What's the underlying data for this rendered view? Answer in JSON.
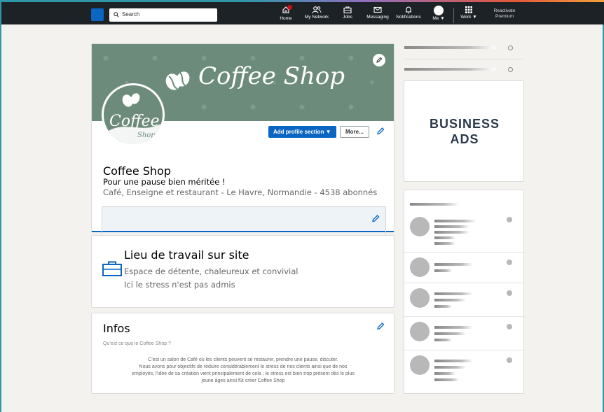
{
  "nav": {
    "search_placeholder": "Search",
    "items": [
      {
        "label": "Home"
      },
      {
        "label": "My Network"
      },
      {
        "label": "Jobs"
      },
      {
        "label": "Messaging"
      },
      {
        "label": "Notifications"
      },
      {
        "label": "Me ▼"
      },
      {
        "label": "Work ▼"
      }
    ],
    "premium_line1": "Reactivate",
    "premium_line2": "Premium"
  },
  "banner": {
    "title": "Coffee Shop",
    "avatar_word": "Coffee",
    "avatar_sub": "Shop"
  },
  "profile": {
    "add_section_label": "Add profile section ▼",
    "more_label": "More...",
    "name": "Coffee Shop",
    "headline": "Pour une pause bien méritée !",
    "subline": "Café, Enseigne et restaurant - Le Havre, Normandie - 4538 abonnés"
  },
  "work": {
    "title": "Lieu de travail sur site",
    "line1": "Espace de détente, chaleureux et convivial",
    "line2": "Ici le stress n'est pas admis"
  },
  "infos": {
    "title": "Infos",
    "question": "Qu'est ce que le Coffee Shop ?",
    "body_1": "C'est un salon de Café où les clients peuvent se restaurer,  prendre une pause, discuter.",
    "body_2": "Nous avons pour objectifs de réduire considérablement le stress de nos clients ainsi que de nos",
    "body_3": "employés, l'idée de sa création vient principalement de cela ; le stress est bien trop présent dès le plus",
    "body_4": "jeune âges ainsi fût créer Coffee Shop"
  },
  "ads": {
    "line1": "BUSINESS",
    "line2": "ADS"
  },
  "colors": {
    "accent": "#0a66c2",
    "banner": "#6d8b7b",
    "navbar": "#1d2226"
  }
}
